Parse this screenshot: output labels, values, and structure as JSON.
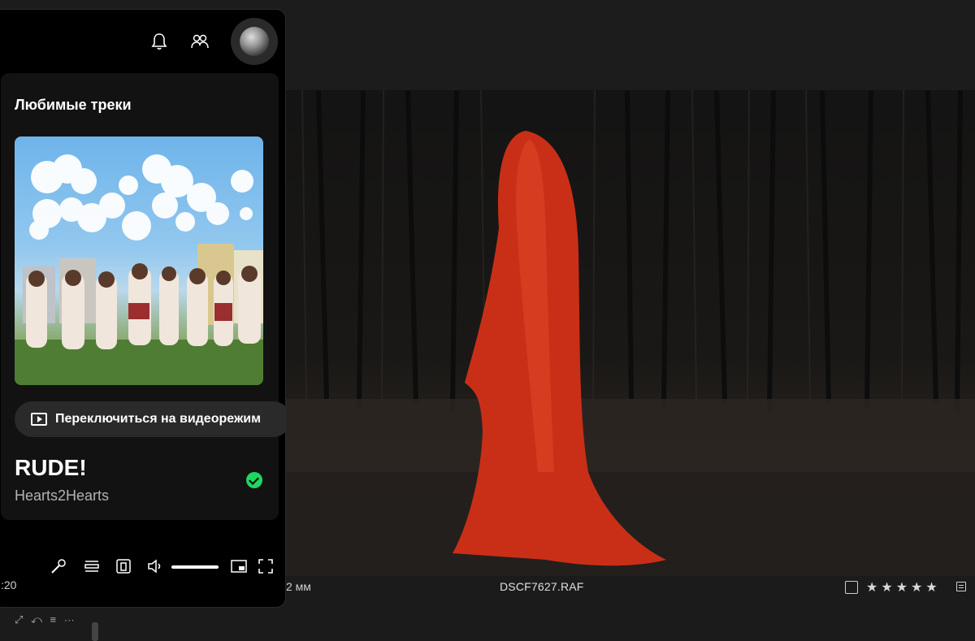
{
  "player": {
    "section_title": "Любимые треки",
    "video_mode_label": "Переключиться на видеорежим",
    "track": {
      "title": "RUDE!",
      "artist": "Hearts2Hearts"
    },
    "elapsed_time_partial": ":20",
    "volume_level": 1.0,
    "icons": [
      "bell-icon",
      "friends-icon",
      "avatar",
      "play-square-icon",
      "check-circle-icon",
      "mic-icon",
      "queue-icon",
      "connect-device-icon",
      "volume-icon",
      "miniplayer-icon",
      "fullscreen-icon"
    ],
    "accent_color": "#1ed760"
  },
  "viewer": {
    "focal_partial": "2 мм",
    "filename": "DSCF7627.RAF",
    "rating_stars": "★★★★★"
  }
}
